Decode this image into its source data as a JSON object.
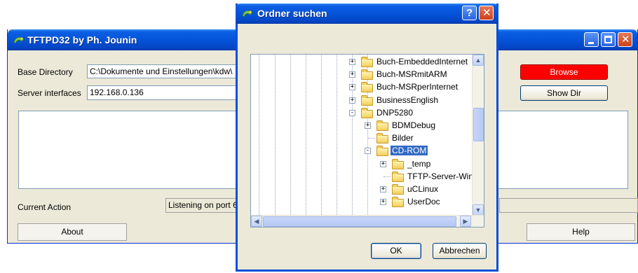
{
  "main_window": {
    "title": "TFTPD32 by Ph. Jounin",
    "base_directory_label": "Base Directory",
    "base_directory_value": "C:\\Dokumente und Einstellungen\\kdw\\",
    "server_interfaces_label": "Server interfaces",
    "server_interfaces_value": "192.168.0.136",
    "browse_label": "Browse",
    "show_dir_label": "Show Dir",
    "current_action_label": "Current Action",
    "current_action_value": "Listening on port 6",
    "about_label": "About",
    "help_label": "Help"
  },
  "dialog": {
    "title": "Ordner suchen",
    "help_glyph": "?",
    "close_glyph": "✕",
    "ok_label": "OK",
    "cancel_label": "Abbrechen",
    "tree": [
      {
        "label": "Buch-EmbeddedInternet",
        "level": 0,
        "expander": "+",
        "selected": false
      },
      {
        "label": "Buch-MSRmitARM",
        "level": 0,
        "expander": "+",
        "selected": false
      },
      {
        "label": "Buch-MSRperInternet",
        "level": 0,
        "expander": "+",
        "selected": false
      },
      {
        "label": "BusinessEnglish",
        "level": 0,
        "expander": "+",
        "selected": false
      },
      {
        "label": "DNP5280",
        "level": 0,
        "expander": "-",
        "selected": false
      },
      {
        "label": "BDMDebug",
        "level": 1,
        "expander": "+",
        "selected": false
      },
      {
        "label": "Bilder",
        "level": 1,
        "expander": "",
        "selected": false
      },
      {
        "label": "CD-ROM",
        "level": 1,
        "expander": "-",
        "selected": true
      },
      {
        "label": "_temp",
        "level": 2,
        "expander": "+",
        "selected": false
      },
      {
        "label": "TFTP-Server-Win",
        "level": 2,
        "expander": "",
        "selected": false
      },
      {
        "label": "uCLinux",
        "level": 2,
        "expander": "+",
        "selected": false
      },
      {
        "label": "UserDoc",
        "level": 2,
        "expander": "+",
        "selected": false
      }
    ]
  },
  "colors": {
    "titlebar": "#0553d8",
    "browse_button": "#ff0000",
    "selection": "#316ac5",
    "window_face": "#ece9d8"
  },
  "icons": {
    "app_icon": "tftpd-icon",
    "folder_icon": "folder-icon"
  }
}
